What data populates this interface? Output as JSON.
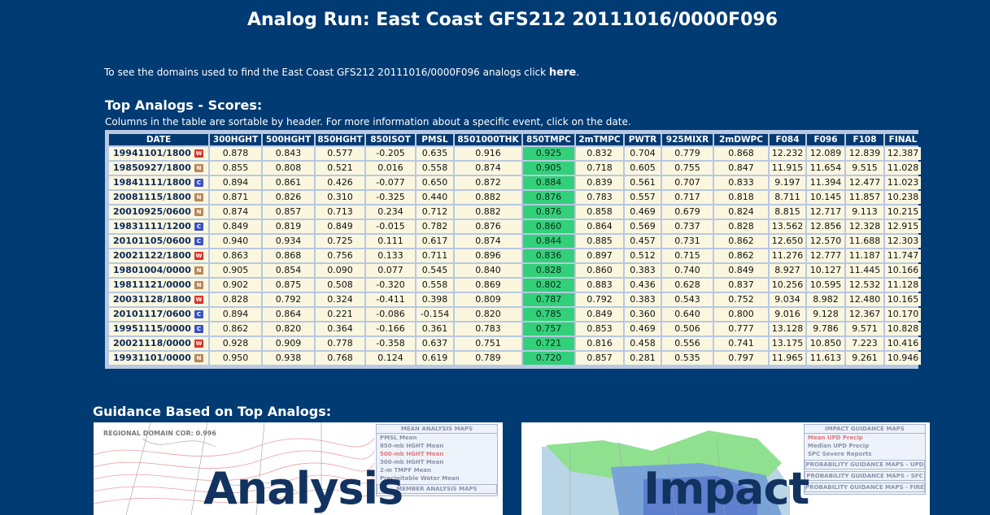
{
  "title": "Analog Run: East Coast GFS212 20111016/0000F096",
  "intro": {
    "text": "To see the domains used to find the East Coast GFS212 20111016/0000F096 analogs click ",
    "link": "here",
    "suffix": "."
  },
  "scores": {
    "title": "Top Analogs - Scores:",
    "subtitle": "Columns in the table are sortable by header. For more information about a specific event, click on the date."
  },
  "table": {
    "headers": [
      "DATE",
      "300HGHT",
      "500HGHT",
      "850HGHT",
      "850ISOT",
      "PMSL",
      "8501000THK",
      "850TMPC",
      "2mTMPC",
      "PWTR",
      "925MIXR",
      "2mDWPC",
      "F084",
      "F096",
      "F108",
      "FINAL"
    ],
    "highlight_column": 7,
    "rows": [
      {
        "date": "19941101/1800",
        "badge": "W",
        "cells": [
          "0.878",
          "0.843",
          "0.577",
          "-0.205",
          "0.635",
          "0.916",
          "0.925",
          "0.832",
          "0.704",
          "0.779",
          "0.868",
          "12.232",
          "12.089",
          "12.839",
          "12.387"
        ]
      },
      {
        "date": "19850927/1800",
        "badge": "N",
        "cells": [
          "0.855",
          "0.808",
          "0.521",
          "0.016",
          "0.558",
          "0.874",
          "0.905",
          "0.718",
          "0.605",
          "0.755",
          "0.847",
          "11.915",
          "11.654",
          "9.515",
          "11.028"
        ]
      },
      {
        "date": "19841111/1800",
        "badge": "C",
        "cells": [
          "0.894",
          "0.861",
          "0.426",
          "-0.077",
          "0.650",
          "0.872",
          "0.884",
          "0.839",
          "0.561",
          "0.707",
          "0.833",
          "9.197",
          "11.394",
          "12.477",
          "11.023"
        ]
      },
      {
        "date": "20081115/1800",
        "badge": "N",
        "cells": [
          "0.871",
          "0.826",
          "0.310",
          "-0.325",
          "0.440",
          "0.882",
          "0.876",
          "0.783",
          "0.557",
          "0.717",
          "0.818",
          "8.711",
          "10.145",
          "11.857",
          "10.238"
        ]
      },
      {
        "date": "20010925/0600",
        "badge": "N",
        "cells": [
          "0.874",
          "0.857",
          "0.713",
          "0.234",
          "0.712",
          "0.882",
          "0.876",
          "0.858",
          "0.469",
          "0.679",
          "0.824",
          "8.815",
          "12.717",
          "9.113",
          "10.215"
        ]
      },
      {
        "date": "19831111/1200",
        "badge": "C",
        "cells": [
          "0.849",
          "0.819",
          "0.849",
          "-0.015",
          "0.782",
          "0.876",
          "0.860",
          "0.864",
          "0.569",
          "0.737",
          "0.828",
          "13.562",
          "12.856",
          "12.328",
          "12.915"
        ]
      },
      {
        "date": "20101105/0600",
        "badge": "C",
        "cells": [
          "0.940",
          "0.934",
          "0.725",
          "0.111",
          "0.617",
          "0.874",
          "0.844",
          "0.885",
          "0.457",
          "0.731",
          "0.862",
          "12.650",
          "12.570",
          "11.688",
          "12.303"
        ]
      },
      {
        "date": "20021122/1800",
        "badge": "W",
        "cells": [
          "0.863",
          "0.868",
          "0.756",
          "0.133",
          "0.711",
          "0.896",
          "0.836",
          "0.897",
          "0.512",
          "0.715",
          "0.862",
          "11.276",
          "12.777",
          "11.187",
          "11.747"
        ]
      },
      {
        "date": "19801004/0000",
        "badge": "N",
        "cells": [
          "0.905",
          "0.854",
          "0.090",
          "0.077",
          "0.545",
          "0.840",
          "0.828",
          "0.860",
          "0.383",
          "0.740",
          "0.849",
          "8.927",
          "10.127",
          "11.445",
          "10.166"
        ]
      },
      {
        "date": "19811121/0000",
        "badge": "N",
        "cells": [
          "0.902",
          "0.875",
          "0.508",
          "-0.320",
          "0.558",
          "0.869",
          "0.802",
          "0.883",
          "0.436",
          "0.628",
          "0.837",
          "10.256",
          "10.595",
          "12.532",
          "11.128"
        ]
      },
      {
        "date": "20031128/1800",
        "badge": "W",
        "cells": [
          "0.828",
          "0.792",
          "0.324",
          "-0.411",
          "0.398",
          "0.809",
          "0.787",
          "0.792",
          "0.383",
          "0.543",
          "0.752",
          "9.034",
          "8.982",
          "12.480",
          "10.165"
        ]
      },
      {
        "date": "20101117/0600",
        "badge": "C",
        "cells": [
          "0.894",
          "0.864",
          "0.221",
          "-0.086",
          "-0.154",
          "0.820",
          "0.785",
          "0.849",
          "0.360",
          "0.640",
          "0.800",
          "9.016",
          "9.128",
          "12.367",
          "10.170"
        ]
      },
      {
        "date": "19951115/0000",
        "badge": "C",
        "cells": [
          "0.862",
          "0.820",
          "0.364",
          "-0.166",
          "0.361",
          "0.783",
          "0.757",
          "0.853",
          "0.469",
          "0.506",
          "0.777",
          "13.128",
          "9.786",
          "9.571",
          "10.828"
        ]
      },
      {
        "date": "20021118/0000",
        "badge": "W",
        "cells": [
          "0.928",
          "0.909",
          "0.778",
          "-0.358",
          "0.637",
          "0.751",
          "0.721",
          "0.816",
          "0.458",
          "0.556",
          "0.741",
          "13.175",
          "10.850",
          "7.223",
          "10.416"
        ]
      },
      {
        "date": "19931101/0000",
        "badge": "N",
        "cells": [
          "0.950",
          "0.938",
          "0.768",
          "0.124",
          "0.619",
          "0.789",
          "0.720",
          "0.857",
          "0.281",
          "0.535",
          "0.797",
          "11.965",
          "11.613",
          "9.261",
          "10.946"
        ]
      }
    ]
  },
  "badge_colors": {
    "W": "#d8332a",
    "N": "#b8865a",
    "C": "#3a52c7"
  },
  "guidance": {
    "title": "Guidance Based on Top Analogs:",
    "analysis": {
      "label": "Analysis",
      "domain_label": "REGIONAL DOMAIN COR: 0.996",
      "menu_head": "MEAN ANALYSIS MAPS",
      "menu_items": [
        "PMSL Mean",
        "850-mb HGHT Mean",
        "500-mb HGHT Mean",
        "300-mb HGHT Mean",
        "2-m TMPF Mean",
        "Precipitable Water Mean"
      ],
      "menu_button": "MEMBER ANALYSIS MAPS"
    },
    "impact": {
      "label": "Impact",
      "menu_head": "IMPACT GUIDANCE MAPS",
      "menu_items": [
        "Mean UPD Precip",
        "Median UPD Precip",
        "SPC Severe Reports"
      ],
      "menu_buttons": [
        "PROBABILITY GUIDANCE MAPS - UPD",
        "PROBABILITY GUIDANCE MAPS - SFC",
        "PROBABILITY GUIDANCE MAPS - FIRE"
      ]
    }
  }
}
